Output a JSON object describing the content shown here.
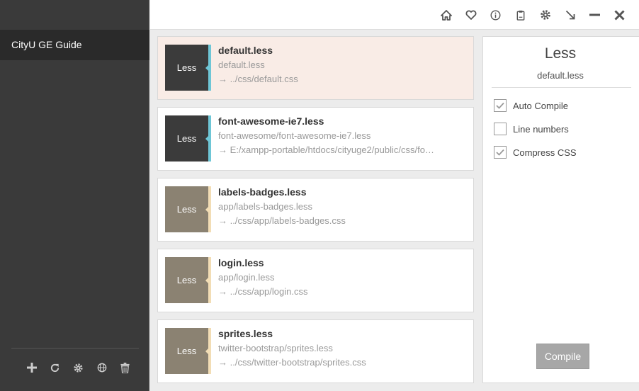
{
  "sidebar": {
    "project_name": "CityU GE Guide",
    "tools": [
      {
        "icon": "plus-icon"
      },
      {
        "icon": "refresh-icon"
      },
      {
        "icon": "gear-icon"
      },
      {
        "icon": "globe-icon"
      },
      {
        "icon": "trash-icon"
      }
    ]
  },
  "topbar": {
    "icons": [
      "home-icon",
      "heart-icon",
      "info-icon",
      "clipboard-icon",
      "gear-icon",
      "arrow-down-right-icon",
      "minimize-icon",
      "close-icon"
    ]
  },
  "files": [
    {
      "badge": "Less",
      "name": "default.less",
      "path": "default.less",
      "output": "→ ../css/default.css",
      "selected": true,
      "style": "dark"
    },
    {
      "badge": "Less",
      "name": "font-awesome-ie7.less",
      "path": "font-awesome/font-awesome-ie7.less",
      "output": "→ E:/xampp-portable/htdocs/cityuge2/public/css/fo…",
      "selected": false,
      "style": "dark"
    },
    {
      "badge": "Less",
      "name": "labels-badges.less",
      "path": "app/labels-badges.less",
      "output": "→ ../css/app/labels-badges.css",
      "selected": false,
      "style": "tan"
    },
    {
      "badge": "Less",
      "name": "login.less",
      "path": "app/login.less",
      "output": "→ ../css/app/login.css",
      "selected": false,
      "style": "tan"
    },
    {
      "badge": "Less",
      "name": "sprites.less",
      "path": "twitter-bootstrap/sprites.less",
      "output": "→ ../css/twitter-bootstrap/sprites.css",
      "selected": false,
      "style": "tan"
    }
  ],
  "panel": {
    "title": "Less",
    "subtitle": "default.less",
    "options": [
      {
        "label": "Auto Compile",
        "checked": true
      },
      {
        "label": "Line numbers",
        "checked": false
      },
      {
        "label": "Compress CSS",
        "checked": true
      }
    ],
    "compile_label": "Compile"
  },
  "colors": {
    "selected_bg": "#f9ece6",
    "badge_dark": "#3b3b3b",
    "badge_tan": "#8b8272",
    "accent_blue": "#6ec6d6",
    "accent_beige": "#f2ddb5"
  }
}
